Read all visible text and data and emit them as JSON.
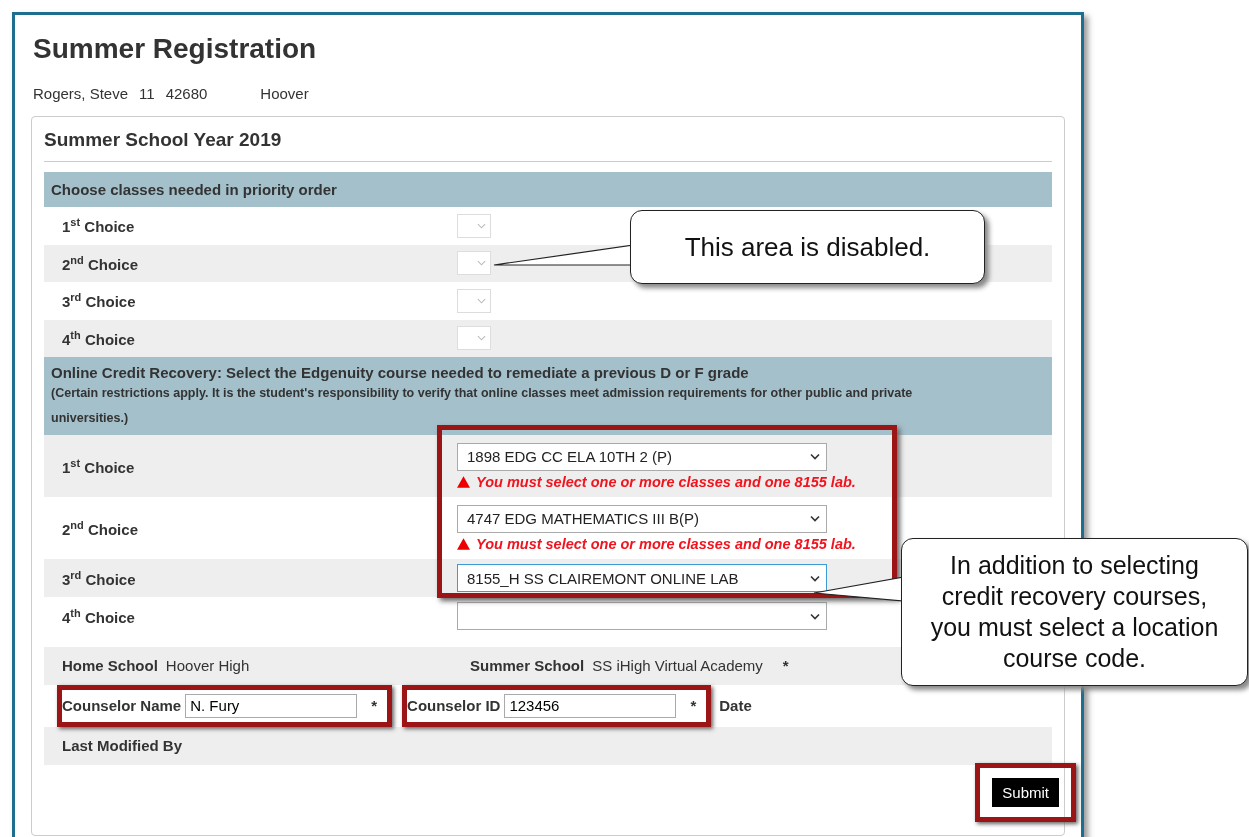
{
  "page": {
    "title": "Summer Registration",
    "student": {
      "name": "Rogers, Steve",
      "grade": "11",
      "id": "42680",
      "school": "Hoover"
    }
  },
  "section": {
    "title": "Summer School Year 2019",
    "classes": {
      "header": "Choose classes needed in priority order",
      "choices": [
        {
          "label": "1$^{st}$ Choice",
          "disabled": true
        },
        {
          "label": "2$^{nd}$ Choice",
          "disabled": true
        },
        {
          "label": "3$^{rd}$ Choice",
          "disabled": true
        },
        {
          "label": "4$^{th}$ Choice",
          "disabled": true
        }
      ]
    },
    "credit_recovery": {
      "header": "Online Credit Recovery: Select the Edgenuity course needed to remediate a previous D or F grade",
      "note": "(Certain restrictions apply. It is the student's responsibility to verify that online classes meet admission requirements for other public and private universities.)",
      "highlighted": true,
      "choices": [
        {
          "label": "1$^{st}$ Choice",
          "value": "1898 EDG CC ELA 10TH 2 (P)",
          "error": "You must select one or more classes and one 8155 lab.",
          "focused": false
        },
        {
          "label": "2$^{nd}$ Choice",
          "value": "4747 EDG MATHEMATICS III B(P)",
          "error": "You must select one or more classes and one 8155 lab.",
          "focused": false
        },
        {
          "label": "3$^{rd}$ Choice",
          "value": "8155_H SS CLAIREMONT ONLINE LAB",
          "focused": true
        },
        {
          "label": "4$^{th}$ Choice",
          "focused": false
        }
      ]
    },
    "home_school": {
      "label": "Home School",
      "value": "Hoover High"
    },
    "summer_school": {
      "label": "Summer School",
      "value": "SS iHigh Virtual Academy",
      "required_mark": "*"
    },
    "counselor_name": {
      "label": "Counselor Name",
      "value": "N. Fury",
      "required_mark": "*",
      "highlighted": true
    },
    "counselor_id": {
      "label": "Counselor ID",
      "value": "123456",
      "required_mark": "*",
      "highlighted": true
    },
    "date": {
      "label": "Date"
    },
    "last_modified_by": {
      "label": "Last Modified By"
    },
    "submit": {
      "label": "Submit",
      "highlighted": true
    }
  },
  "callouts": [
    {
      "text": "This area is disabled."
    },
    {
      "text": "In addition to selecting credit recovery courses, you must select a location course code."
    }
  ]
}
